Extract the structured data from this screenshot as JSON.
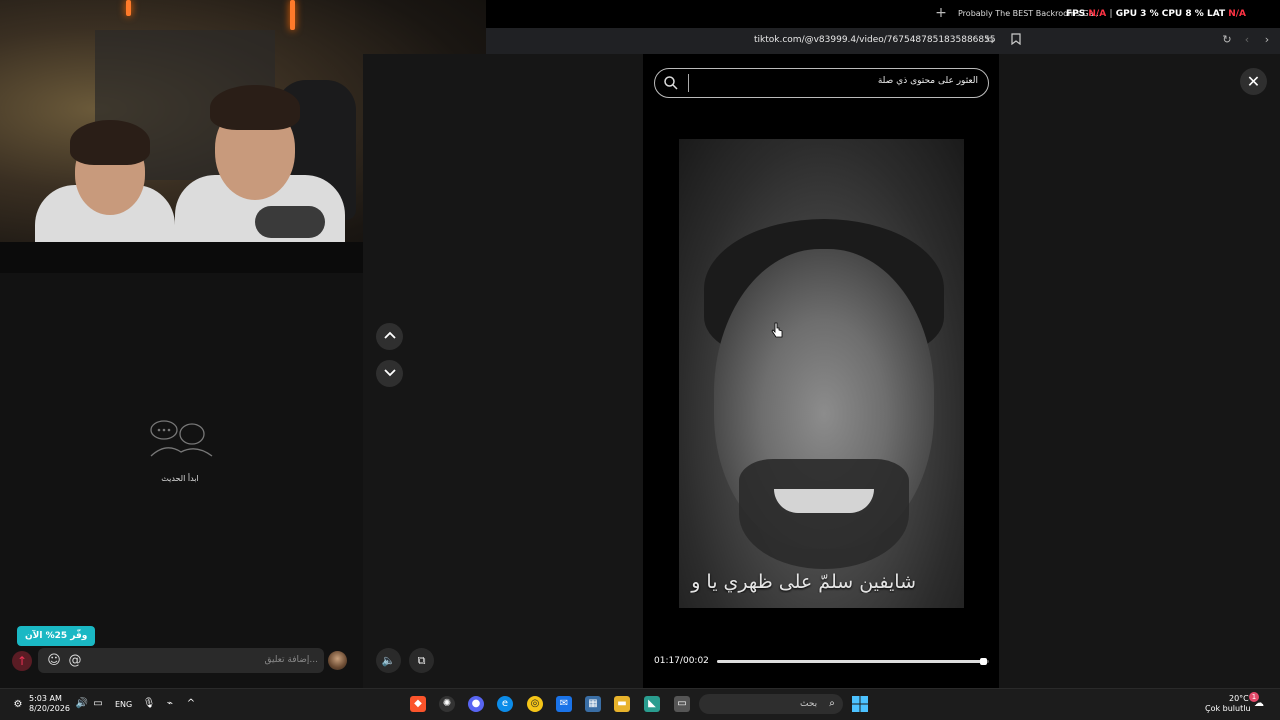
{
  "browser": {
    "tab_title": "Probably The BEST Backrooms Ga...",
    "url": "tiktok.com/@v83999.4/video/7675487851835886855"
  },
  "overlay": {
    "fps_label": "FPS",
    "fps_value": "N/A",
    "gpu_label": "GPU",
    "gpu_value": "3 %",
    "cpu_label": "CPU",
    "cpu_value": "8 %",
    "lat_label": "LAT",
    "lat_value": "N/A"
  },
  "comments": {
    "empty_text": "ابدأ الحديث",
    "promo_text": "وفّر 25% الآن",
    "placeholder": "إضافة تعليق..."
  },
  "search": {
    "placeholder": "العثور على محتوى ذي صلة"
  },
  "video": {
    "caption": "شايفين سلمّ على ظهري يا و",
    "time_text": "01:17/00:02",
    "progress": 0.98
  },
  "taskbar": {
    "time": "5:03 AM",
    "date": "8/20/2026",
    "lang": "ENG",
    "search_text": "بحث",
    "weather_temp": "20°C",
    "weather_desc": "Çok bulutlu",
    "notif_count": "1"
  },
  "colors": {
    "accent": "#1ab8c4",
    "fps_na": "#ff3344",
    "background": "#161616"
  }
}
